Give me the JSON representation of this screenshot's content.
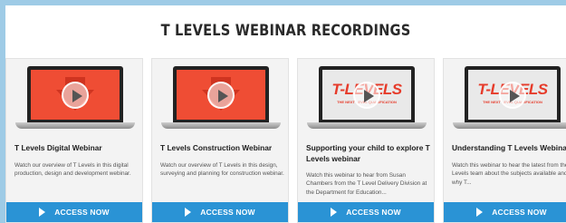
{
  "section": {
    "title": "T LEVELS WEBINAR RECORDINGS"
  },
  "cards": [
    {
      "title": "T Levels Digital Webinar",
      "description": "Watch our overview of T Levels in this digital production, design and development webinar.",
      "button_label": "ACCESS NOW"
    },
    {
      "title": "T Levels Construction Webinar",
      "description": "Watch our overview of T Levels in this design, surveying and planning for construction webinar.",
      "button_label": "ACCESS NOW"
    },
    {
      "title": "Supporting your child to explore T Levels webinar",
      "description": "Watch this webinar to hear from Susan Chambers from the T Level Delivery Division at the Department for Education...",
      "button_label": "ACCESS NOW",
      "logo_text": "T-LEVELS",
      "logo_subtext": "THE NEXT LEVEL QUALIFICATION"
    },
    {
      "title": "Understanding T Levels Webinar",
      "description": "Watch this webinar to hear the latest from the T Levels team about the subjects available and why T...",
      "button_label": "ACCESS NOW",
      "logo_text": "T-LEVELS",
      "logo_subtext": "THE NEXT LEVEL QUALIFICATION"
    }
  ],
  "colors": {
    "accent": "#2a93d5",
    "thumb_red": "#ef4d34",
    "logo_red": "#e63b2a"
  },
  "icons": {
    "video": "play-icon",
    "button": "play-arrow-icon"
  }
}
